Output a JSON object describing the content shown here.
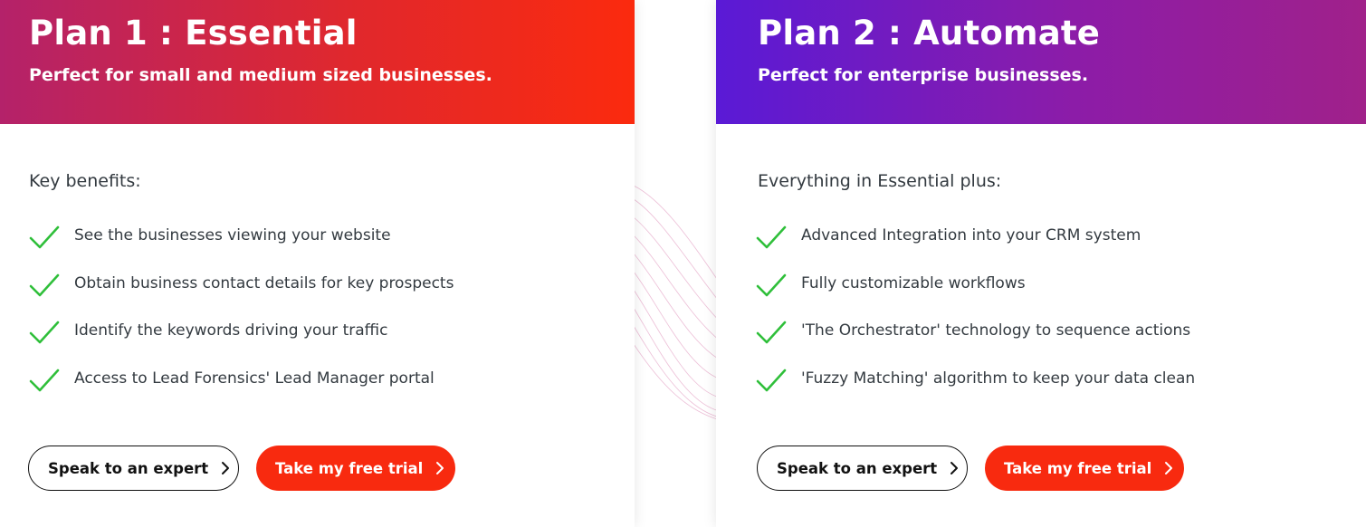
{
  "plans": [
    {
      "title": "Plan 1 : Essential",
      "subtitle": "Perfect for small and medium sized businesses.",
      "section_heading": "Key benefits:",
      "benefits": [
        "See the businesses viewing your website",
        "Obtain business contact details for key prospects",
        "Identify the keywords driving your traffic",
        "Access to Lead Forensics' Lead Manager portal"
      ],
      "expert_button": "Speak to an expert",
      "trial_button": "Take my free trial"
    },
    {
      "title": "Plan 2 : Automate",
      "subtitle": "Perfect for enterprise businesses.",
      "section_heading": "Everything in Essential plus:",
      "benefits": [
        "Advanced Integration into your CRM system",
        "Fully customizable workflows",
        "'The Orchestrator' technology to sequence actions",
        "'Fuzzy Matching' algorithm to keep your data clean"
      ],
      "expert_button": "Speak to an expert",
      "trial_button": "Take my free trial"
    }
  ],
  "icons": {
    "benefit": "checkmark-icon",
    "button": "chevron-right-icon"
  },
  "colors": {
    "essential_gradient": [
      "#b4226a",
      "#fb2a0e"
    ],
    "automate_gradient": [
      "#5a1ad6",
      "#a0218a"
    ],
    "check_green": "#2fbf3a",
    "cta_red": "#f82a0f",
    "body_text": "#333a40"
  }
}
